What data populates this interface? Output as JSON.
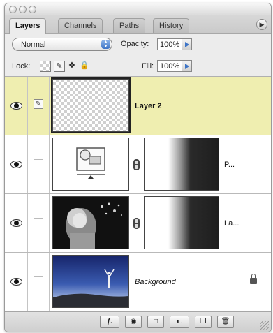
{
  "tabs": [
    {
      "label": "Layers",
      "active": true
    },
    {
      "label": "Channels",
      "active": false
    },
    {
      "label": "Paths",
      "active": false
    },
    {
      "label": "History",
      "active": false
    }
  ],
  "panel_menu_icon": "panel-menu-arrow-icon",
  "blend_mode": {
    "value": "Normal"
  },
  "opacity": {
    "label": "Opacity:",
    "value": "100%"
  },
  "lock": {
    "label": "Lock:",
    "icons": [
      "lock-transparent-pixels-icon",
      "lock-image-pixels-icon",
      "lock-position-icon",
      "lock-all-icon"
    ]
  },
  "fill": {
    "label": "Fill:",
    "value": "100%"
  },
  "layers": [
    {
      "name": "Layer 2",
      "selected": true,
      "visible": true,
      "has_brush": true,
      "thumb": "transparent"
    },
    {
      "name": "P...",
      "selected": false,
      "visible": true,
      "thumb": "adjustment-icon",
      "has_mask": true
    },
    {
      "name": "La...",
      "selected": false,
      "visible": true,
      "thumb": "photo-child-bubbles",
      "has_mask": true
    },
    {
      "name": "Background",
      "selected": false,
      "visible": true,
      "thumb": "photo-sky-figure",
      "locked": true
    }
  ],
  "bottom_buttons": [
    "layer-style-icon",
    "layer-mask-icon",
    "layer-set-icon",
    "adjustment-layer-icon",
    "new-layer-icon",
    "trash-icon"
  ],
  "colors": {
    "selected_row": "#efeeb0",
    "accent_blue": "#3d74c6"
  }
}
